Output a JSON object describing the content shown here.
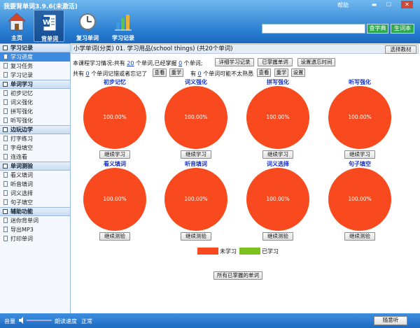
{
  "app": {
    "title": "我要背单词3.9.6(未激活)",
    "help": "帮助",
    "min": "▬",
    "max": "☐",
    "close": "✕"
  },
  "nav": [
    {
      "label": "主页"
    },
    {
      "label": "背单词"
    },
    {
      "label": "复习单词"
    },
    {
      "label": "学习记录"
    }
  ],
  "search": {
    "value": "",
    "dict_btn": "查字典",
    "vocab_btn": "生词本"
  },
  "sidebar": {
    "sections": [
      {
        "title": "学习记录",
        "items": [
          "学习进度",
          "复习任务",
          "学习记录"
        ]
      },
      {
        "title": "单词学习",
        "items": [
          "初步记忆",
          "词义强化",
          "拼写强化",
          "听写强化"
        ]
      },
      {
        "title": "边玩边学",
        "items": [
          "打字练习",
          "字母填空",
          "连连看"
        ]
      },
      {
        "title": "单词测验",
        "items": [
          "看义填词",
          "听音填词",
          "词义选择",
          "句子填空"
        ]
      },
      {
        "title": "辅助功能",
        "items": [
          "迷你背单词",
          "导出MP3",
          "打印单词"
        ]
      }
    ]
  },
  "header": {
    "course": "小学单词(分类) 01. 学习用品(school things) (共20个单词)",
    "choose_btn": "选择教材"
  },
  "summary": {
    "l1_pre": "本课程学习情况:共有",
    "total": "20",
    "l1_mid": "个单词,已经掌握",
    "mastered": "0",
    "l1_post": "个单词;",
    "btn_detail": "详细学习记录",
    "btn_mastered": "已掌握单词",
    "btn_forget": "设置遗忘时间",
    "l2_pre": "共有",
    "forgot": "0",
    "l2_post": "个单词记错或者忘记了",
    "btn_view": "查看",
    "btn_relearn": "重学",
    "l3_pre": "有",
    "unfamiliar": "0",
    "l3_post": "个单词可能不太熟悉",
    "btn_view2": "查看",
    "btn_relearn2": "重学",
    "btn_settings": "设置"
  },
  "pies": [
    {
      "title": "初步记忆",
      "unlearned_pct": "100.00%",
      "action": "继续学习"
    },
    {
      "title": "词义强化",
      "unlearned_pct": "100.00%",
      "action": "继续学习"
    },
    {
      "title": "拼写强化",
      "unlearned_pct": "100.00%",
      "action": "继续学习"
    },
    {
      "title": "听写强化",
      "unlearned_pct": "100.00%",
      "action": "继续学习"
    },
    {
      "title": "看义填词",
      "unlearned_pct": "100.00%",
      "action": "继续测验"
    },
    {
      "title": "听音填词",
      "unlearned_pct": "100.00%",
      "action": "继续测验"
    },
    {
      "title": "词义选择",
      "unlearned_pct": "100.00%",
      "action": "继续测验"
    },
    {
      "title": "句子填空",
      "unlearned_pct": "100.00%",
      "action": "继续测验"
    }
  ],
  "legend": {
    "unlearned": "未学习",
    "learned": "已学习",
    "unlearned_color": "#f84a1e",
    "learned_color": "#7dc11e"
  },
  "all_mastered_btn": "所有已掌握的单词",
  "status": {
    "volume": "音量",
    "speed_label": "朗读速度",
    "speed_value": "正常",
    "listen_btn": "随意听"
  }
}
